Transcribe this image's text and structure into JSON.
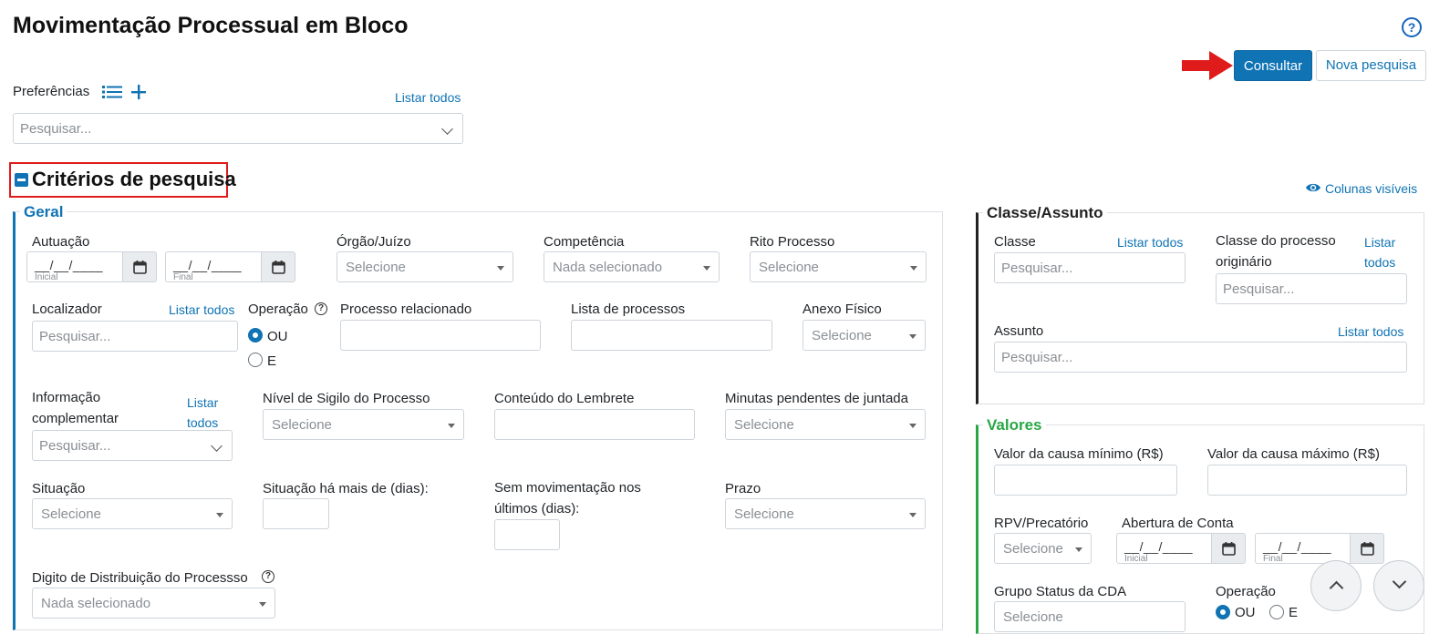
{
  "page": {
    "title": "Movimentação Processual em Bloco"
  },
  "header_actions": {
    "consultar": "Consultar",
    "nova_pesquisa": "Nova pesquisa"
  },
  "preferences": {
    "label": "Preferências",
    "list_all": "Listar todos",
    "placeholder": "Pesquisar..."
  },
  "criteria": {
    "title": "Critérios de pesquisa",
    "visible_columns": "Colunas visíveis"
  },
  "geral": {
    "legend": "Geral",
    "autuacao": {
      "label": "Autuação",
      "mask": "__/__/____",
      "start_hint": "Inicial",
      "end_hint": "Final"
    },
    "orgao": {
      "label": "Órgão/Juízo",
      "value": "Selecione"
    },
    "competencia": {
      "label": "Competência",
      "value": "Nada selecionado"
    },
    "rito": {
      "label": "Rito Processo",
      "value": "Selecione"
    },
    "localizador": {
      "label": "Localizador",
      "link": "Listar todos",
      "placeholder": "Pesquisar..."
    },
    "operacao": {
      "label": "Operação",
      "option_ou": "OU",
      "option_e": "E",
      "selected": "OU"
    },
    "processo_relacionado": {
      "label": "Processo relacionado"
    },
    "lista_processos": {
      "label": "Lista de processos"
    },
    "anexo_fisico": {
      "label": "Anexo Físico",
      "value": "Selecione"
    },
    "informacao": {
      "label": "Informação complementar",
      "link": "Listar todos",
      "placeholder": "Pesquisar..."
    },
    "sigilo": {
      "label": "Nível de Sigilo do Processo",
      "value": "Selecione"
    },
    "lembrete": {
      "label": "Conteúdo do Lembrete"
    },
    "minutas": {
      "label": "Minutas pendentes de juntada",
      "value": "Selecione"
    },
    "situacao": {
      "label": "Situação",
      "value": "Selecione"
    },
    "situacao_dias": {
      "label": "Situação há mais de (dias):"
    },
    "sem_mov": {
      "label": "Sem movimentação nos últimos (dias):"
    },
    "prazo": {
      "label": "Prazo",
      "value": "Selecione"
    },
    "digito": {
      "label": "Digito de Distribuição do Processso",
      "value": "Nada selecionado"
    }
  },
  "classe_assunto": {
    "legend": "Classe/Assunto",
    "classe": {
      "label": "Classe",
      "link": "Listar todos",
      "placeholder": "Pesquisar..."
    },
    "classe_originario": {
      "label": "Classe do processo originário",
      "link": "Listar todos",
      "placeholder": "Pesquisar..."
    },
    "assunto": {
      "label": "Assunto",
      "link": "Listar todos",
      "placeholder": "Pesquisar..."
    }
  },
  "valores": {
    "legend": "Valores",
    "minimo": {
      "label": "Valor da causa mínimo (R$)"
    },
    "maximo": {
      "label": "Valor da causa máximo (R$)"
    },
    "rpv": {
      "label": "RPV/Precatório",
      "value": "Selecione"
    },
    "abertura": {
      "label": "Abertura de Conta",
      "mask": "__/__/____",
      "start_hint": "Inicial",
      "end_hint": "Final"
    },
    "grupo_cda": {
      "label": "Grupo Status da CDA",
      "value": "Selecione"
    },
    "operacao": {
      "label": "Operação",
      "option_ou": "OU",
      "option_e": "E",
      "selected": "OU"
    }
  },
  "colors": {
    "primary": "#0f73b4",
    "legend_geral": "#0f73b4",
    "legend_classe": "#222222",
    "legend_valores": "#28a745",
    "highlight": "#e01b1b"
  },
  "icons": [
    "help-circle-icon",
    "red-arrow-icon",
    "list-icon",
    "plus-icon",
    "minus-square-icon",
    "eye-icon",
    "calendar-icon",
    "chevron-down-icon",
    "chevron-up-icon"
  ]
}
